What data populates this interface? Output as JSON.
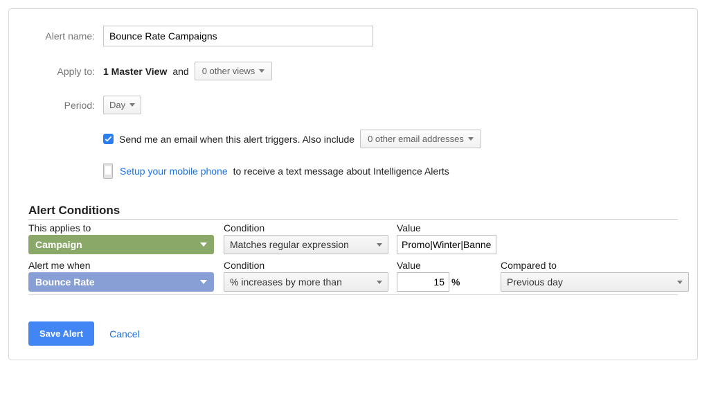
{
  "labels": {
    "alert_name": "Alert name:",
    "apply_to": "Apply to:",
    "period": "Period:"
  },
  "alert_name_value": "Bounce Rate Campaigns",
  "apply_to": {
    "view_name": "1 Master View",
    "and": "and",
    "other_views": "0 other views"
  },
  "period_value": "Day",
  "email": {
    "checkbox_checked": true,
    "text_before": "Send me an email when this alert triggers. Also include",
    "other_emails": "0 other email addresses"
  },
  "mobile": {
    "link": "Setup your mobile phone",
    "text_after": "to receive a text message about Intelligence Alerts"
  },
  "conditions": {
    "heading": "Alert Conditions",
    "row1": {
      "applies_label": "This applies to",
      "condition_label": "Condition",
      "value_label": "Value",
      "applies_value": "Campaign",
      "condition_value": "Matches regular expression",
      "value_value": "Promo|Winter|Banner"
    },
    "row2": {
      "alert_label": "Alert me when",
      "condition_label": "Condition",
      "value_label": "Value",
      "compared_label": "Compared to",
      "alert_value": "Bounce Rate",
      "condition_value": "% increases by more than",
      "value_value": "15",
      "pct": "%",
      "compared_value": "Previous day"
    }
  },
  "actions": {
    "save": "Save Alert",
    "cancel": "Cancel"
  }
}
